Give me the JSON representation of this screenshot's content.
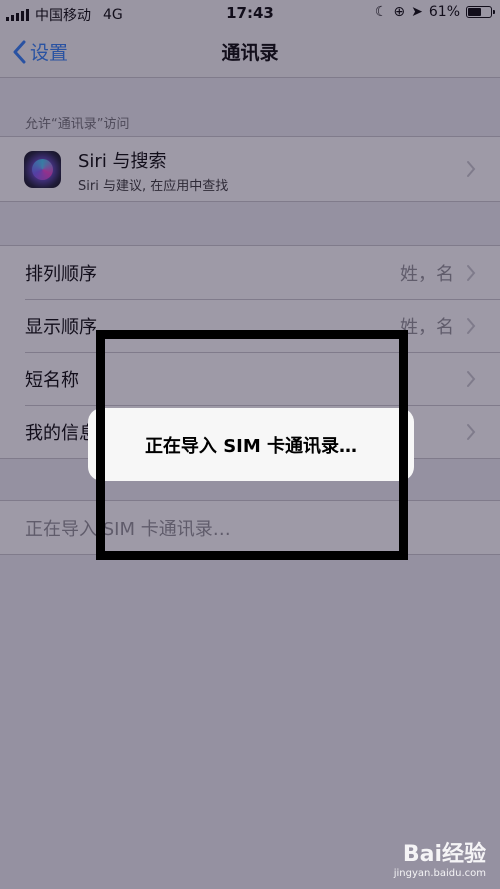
{
  "status_bar": {
    "carrier": "中国移动",
    "network": "4G",
    "time": "17:43",
    "battery": "61%",
    "battery_level": 0.61
  },
  "nav": {
    "back_label": "设置",
    "title": "通讯录"
  },
  "access_section": {
    "header": "允许“通讯录”访问",
    "siri": {
      "title": "Siri 与搜索",
      "subtitle": "Siri 与建议, 在应用中查找"
    }
  },
  "settings": {
    "rows": [
      {
        "label": "排列顺序",
        "value": "姓，名"
      },
      {
        "label": "显示顺序",
        "value": "姓，名"
      },
      {
        "label": "短名称",
        "value": ""
      },
      {
        "label": "我的信息",
        "value": ""
      }
    ]
  },
  "import_row": {
    "label": "正在导入 SIM 卡通讯录…"
  },
  "alert": {
    "message": "正在导入 SIM 卡通讯录…"
  },
  "watermark": {
    "brand": "Bai经验",
    "url": "jingyan.baidu.com"
  },
  "colors": {
    "accent": "#2a7cf6",
    "annotation_box": "#000000"
  }
}
